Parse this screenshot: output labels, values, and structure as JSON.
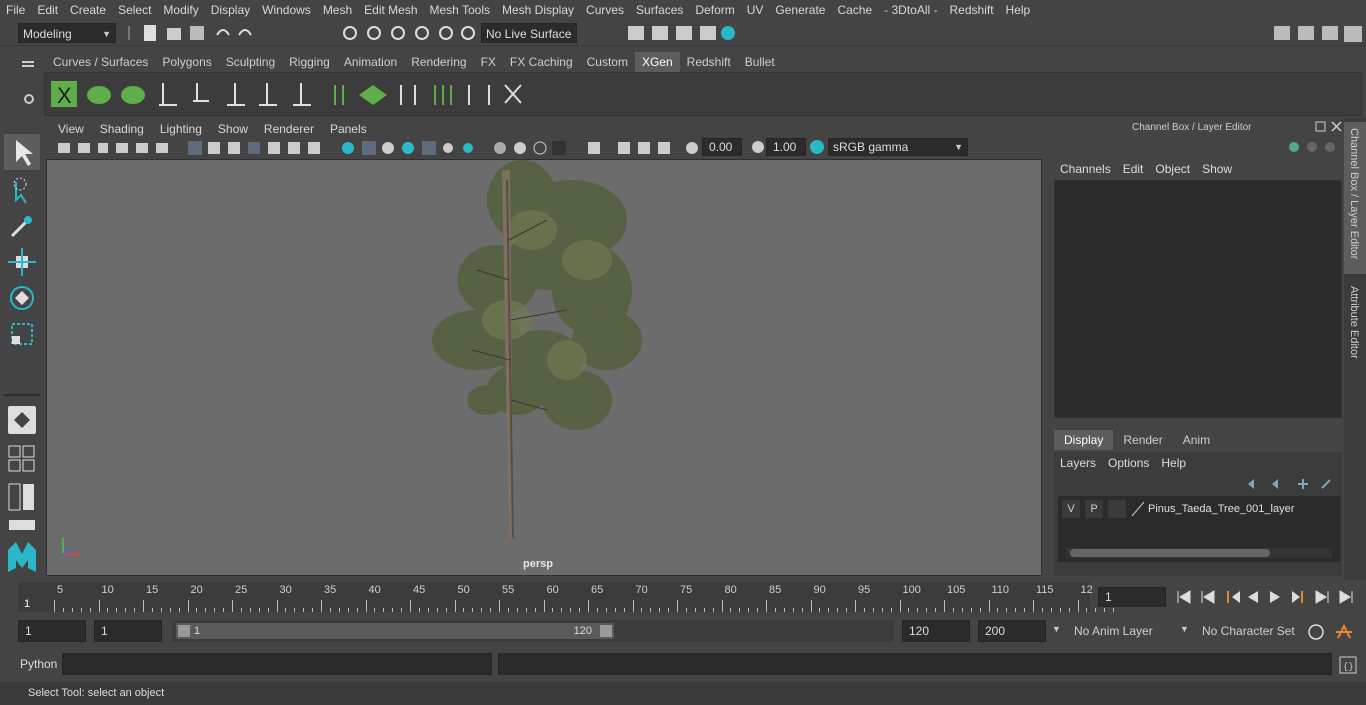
{
  "menubar": [
    "File",
    "Edit",
    "Create",
    "Select",
    "Modify",
    "Display",
    "Windows",
    "Mesh",
    "Edit Mesh",
    "Mesh Tools",
    "Mesh Display",
    "Curves",
    "Surfaces",
    "Deform",
    "UV",
    "Generate",
    "Cache",
    "- 3DtoAll -",
    "Redshift",
    "Help"
  ],
  "status": {
    "mode": "Modeling",
    "live_surface": "No Live Surface"
  },
  "shelf": {
    "tabs": [
      "Curves / Surfaces",
      "Polygons",
      "Sculpting",
      "Rigging",
      "Animation",
      "Rendering",
      "FX",
      "FX Caching",
      "Custom",
      "XGen",
      "Redshift",
      "Bullet"
    ],
    "active_tab": "XGen"
  },
  "panel": {
    "menu": [
      "View",
      "Shading",
      "Lighting",
      "Show",
      "Renderer",
      "Panels"
    ],
    "exposure": "0.00",
    "gamma": "1.00",
    "color_space": "sRGB gamma",
    "camera_label": "persp"
  },
  "channelbox": {
    "title": "Channel Box / Layer Editor",
    "menu": [
      "Channels",
      "Edit",
      "Object",
      "Show"
    ],
    "layer_tabs": [
      "Display",
      "Render",
      "Anim"
    ],
    "active_layer_tab": "Display",
    "layer_menu": [
      "Layers",
      "Options",
      "Help"
    ],
    "layer": {
      "v": "V",
      "p": "P",
      "name": "Pinus_Taeda_Tree_001_layer"
    }
  },
  "sidetabs": [
    "Channel Box / Layer Editor",
    "Attribute Editor"
  ],
  "timeline": {
    "ticks": [
      "5",
      "10",
      "15",
      "20",
      "25",
      "30",
      "35",
      "40",
      "45",
      "50",
      "55",
      "60",
      "65",
      "70",
      "75",
      "80",
      "85",
      "90",
      "95",
      "100",
      "105",
      "110",
      "115",
      "12"
    ],
    "start_label": "1",
    "current_frame": "1"
  },
  "range": {
    "start": "1",
    "start2": "1",
    "slider_start": "1",
    "slider_end": "120",
    "end": "120",
    "end2": "200",
    "anim_layer": "No Anim Layer",
    "character_set": "No Character Set"
  },
  "cmdline": {
    "lang": "Python"
  },
  "helpline": {
    "text": "Select Tool: select an object"
  },
  "colors": {
    "accent_xgen": "#5d5d5d",
    "viewport_bg": "#6c6c6c",
    "icon_green": "#5fae4a",
    "icon_teal": "#2ab7c7"
  }
}
